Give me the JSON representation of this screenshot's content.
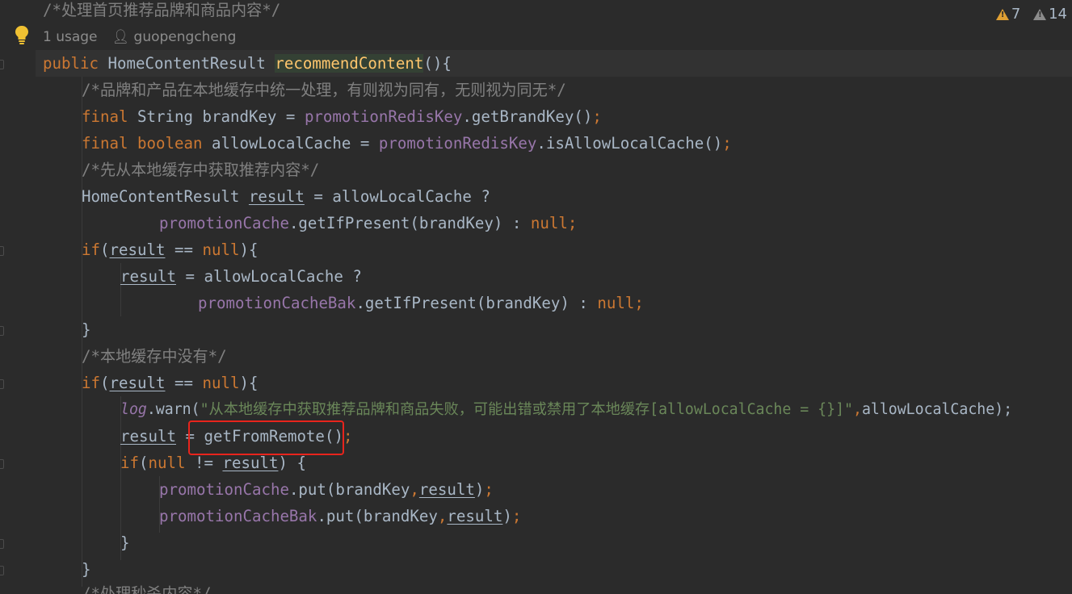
{
  "inspections": {
    "warnings": "7",
    "weak_warnings": "14"
  },
  "inlay": {
    "usages": "1 usage",
    "author": "guopengcheng"
  },
  "colors": {
    "background": "#2b2b2b",
    "keyword": "#cc7832",
    "comment": "#808080",
    "field": "#9876aa",
    "method_decl": "#ffc66d",
    "string": "#6a8759",
    "text": "#a9b7c6",
    "highlight_box": "#e8241c"
  },
  "code": {
    "l0": {
      "comment": "/*处理首页推荐品牌和商品内容*/"
    },
    "l1": {
      "kw_public": "public",
      "type": "HomeContentResult",
      "method": "recommendContent",
      "tail": "(){"
    },
    "l2": {
      "comment": "/*品牌和产品在本地缓存中统一处理，有则视为同有，无则视为同无*/"
    },
    "l3": {
      "kw_final": "final",
      "type": "String",
      "var": "brandKey",
      "eq": " = ",
      "field": "promotionRedisKey",
      "call": ".getBrandKey()",
      "semi": ";"
    },
    "l4": {
      "kw_final": "final",
      "kw_bool": "boolean",
      "var": "allowLocalCache",
      "eq": " = ",
      "field": "promotionRedisKey",
      "call": ".isAllowLocalCache()",
      "semi": ";"
    },
    "l5": {
      "comment": "/*先从本地缓存中获取推荐内容*/"
    },
    "l6": {
      "type": "HomeContentResult",
      "var": "result",
      "rest": " = allowLocalCache ?"
    },
    "l7": {
      "field": "promotionCache",
      "call": ".getIfPresent(brandKey) : ",
      "kw_null": "null",
      "semi": ";"
    },
    "l8": {
      "kw_if": "if",
      "open": "(",
      "var": "result",
      "op": " == ",
      "kw_null": "null",
      "close": "){"
    },
    "l9": {
      "var": "result",
      "rest": " = allowLocalCache ?"
    },
    "l10": {
      "field": "promotionCacheBak",
      "call": ".getIfPresent(brandKey) : ",
      "kw_null": "null",
      "semi": ";"
    },
    "l11": {
      "brace": "}"
    },
    "l12": {
      "comment": "/*本地缓存中没有*/"
    },
    "l13": {
      "kw_if": "if",
      "open": "(",
      "var": "result",
      "op": " == ",
      "kw_null": "null",
      "close": "){"
    },
    "l14": {
      "field": "log",
      "call": ".warn(",
      "string": "\"从本地缓存中获取推荐品牌和商品失败，可能出错或禁用了本地缓存[allowLocalCache = {}]\"",
      "comma": ",",
      "rest": "allowLocalCache);"
    },
    "l15": {
      "var": "result",
      "eq": " = ",
      "call": "getFromRemote",
      "paren_open": "(",
      "paren_close": ")",
      "semi": ";"
    },
    "l16": {
      "kw_if": "if",
      "open": "(",
      "kw_null": "null",
      "op": " != ",
      "var": "result",
      "close": ") {"
    },
    "l17": {
      "field": "promotionCache",
      "call": ".put(brandKey",
      "comma": ",",
      "var": "result",
      "close": ")",
      "semi": ";"
    },
    "l18": {
      "field": "promotionCacheBak",
      "call": ".put(brandKey",
      "comma": ",",
      "var": "result",
      "close": ")",
      "semi": ";"
    },
    "l19": {
      "brace": "}"
    },
    "l20": {
      "brace": "}"
    },
    "l21": {
      "comment": "/*处理秒杀内容*/"
    }
  }
}
